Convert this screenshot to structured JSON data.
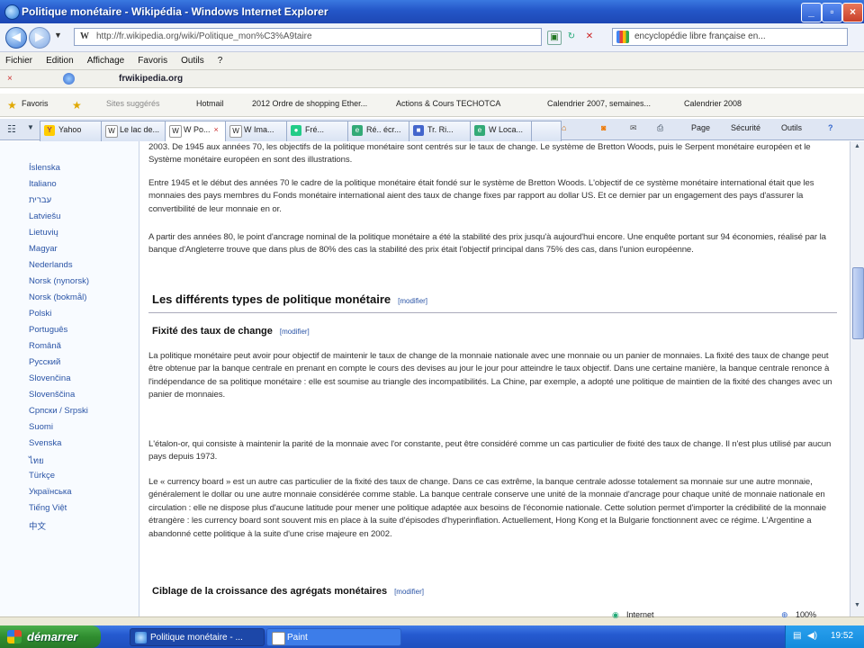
{
  "window": {
    "title": "Politique monétaire - Wikipédia - Windows Internet Explorer"
  },
  "address": {
    "url": "http://fr.wikipedia.org/wiki/Politique_mon%C3%A9taire",
    "search": "encyclopédie libre française en..."
  },
  "menu": [
    "Fichier",
    "Edition",
    "Affichage",
    "Favoris",
    "Outils",
    "?"
  ],
  "links_bar": {
    "label": "frwikipedia.org"
  },
  "favorites": [
    "Favoris",
    "Sites suggérés",
    "Hotmail",
    "2012 Ordre de shopping Ether...",
    "Actions & Cours TECHOTCA",
    "Calendrier 2007, semaines...",
    "Calendrier 2008"
  ],
  "tabs": [
    {
      "label": "Yahoo"
    },
    {
      "label": "Le lac de..."
    },
    {
      "label": "W Po...",
      "close": "×"
    },
    {
      "label": "W Ima..."
    },
    {
      "label": "Fré..."
    },
    {
      "label": "Ré.. écr..."
    },
    {
      "label": "Tr. Ri..."
    },
    {
      "label": "W Loca..."
    }
  ],
  "toolbar": {
    "page": "Page",
    "security": "Sécurité",
    "tools": "Outils"
  },
  "sidebar": {
    "languages": [
      "Íslenska",
      "Italiano",
      "עברית",
      "Latviešu",
      "Lietuvių",
      "Magyar",
      "Nederlands",
      "Norsk (nynorsk)",
      "Norsk (bokmål)",
      "Polski",
      "Português",
      "Română",
      "Русский",
      "Slovenčina",
      "Slovenščina",
      "Српски / Srpski",
      "Suomi",
      "Svenska",
      "ไทย",
      "Türkçe",
      "Українська",
      "Tiếng Việt",
      "中文"
    ]
  },
  "article": {
    "p0": "2003. De 1945 aux années 70, les objectifs de la politique monétaire sont centrés sur le taux de change. Le système de Bretton Woods, puis le Serpent monétaire européen et le Système monétaire européen en sont des illustrations.",
    "p1": "Entre 1945 et le début des années 70 le cadre de la politique monétaire était fondé sur le système de Bretton Woods. L'objectif de ce système monétaire international était que les monnaies des pays membres du Fonds monétaire international aient des taux de change fixes par rapport au dollar US. Et ce dernier par un engagement des pays d'assurer la convertibilité de leur monnaie en or.",
    "p2": "A partir des années 80, le point d'ancrage nominal de la politique monétaire a été la stabilité des prix jusqu'à aujourd'hui encore. Une enquête portant sur 94 économies, réalisé par la banque d'Angleterre trouve que dans plus de 80% des cas la stabilité des prix était l'objectif principal dans 75% des cas, dans l'union européenne.",
    "h2": "Les différents types de politique monétaire",
    "h2_edit": "[modifier]",
    "h3a": "Fixité des taux de change",
    "h3a_edit": "[modifier]",
    "p3": "La politique monétaire peut avoir pour objectif de maintenir le taux de change de la monnaie nationale avec une monnaie ou un panier de monnaies. La fixité des taux de change peut être obtenue par la banque centrale en prenant en compte le cours des devises au jour le jour pour atteindre le taux objectif. Dans une certaine manière, la banque centrale renonce à l'indépendance de sa politique monétaire : elle est soumise au triangle des incompatibilités. La Chine, par exemple, a adopté une politique de maintien de la fixité des changes avec un panier de monnaies.",
    "p4": "L'étalon-or, qui consiste à maintenir la parité de la monnaie avec l'or constante, peut être considéré comme un cas particulier de fixité des taux de change. Il n'est plus utilisé par aucun pays depuis 1973.",
    "p5": "Le « currency board » est un autre cas particulier de la fixité des taux de change. Dans ce cas extrême, la banque centrale adosse totalement sa monnaie sur une autre monnaie, généralement le dollar ou une autre monnaie considérée comme stable. La banque centrale conserve une unité de la monnaie d'ancrage pour chaque unité de monnaie nationale en circulation : elle ne dispose plus d'aucune latitude pour mener une politique adaptée aux besoins de l'économie nationale. Cette solution permet d'importer la crédibilité de la monnaie étrangère : les currency board sont souvent mis en place à la suite d'épisodes d'hyperinflation. Actuellement, Hong Kong et la Bulgarie fonctionnent avec ce régime. L'Argentine a abandonné cette politique à la suite d'une crise majeure en 2002.",
    "h3b": "Ciblage de la croissance des agrégats monétaires",
    "h3b_edit": "[modifier]"
  },
  "status": {
    "zone": "Internet",
    "zoom": "100%"
  },
  "taskbar": {
    "start": "démarrer",
    "tasks": [
      "Politique monétaire - ...",
      "Paint"
    ],
    "clock": "19:52"
  },
  "colors": {
    "link": "#2a54a6",
    "titlebar": "#2456c8",
    "start": "#2f8d2f"
  }
}
